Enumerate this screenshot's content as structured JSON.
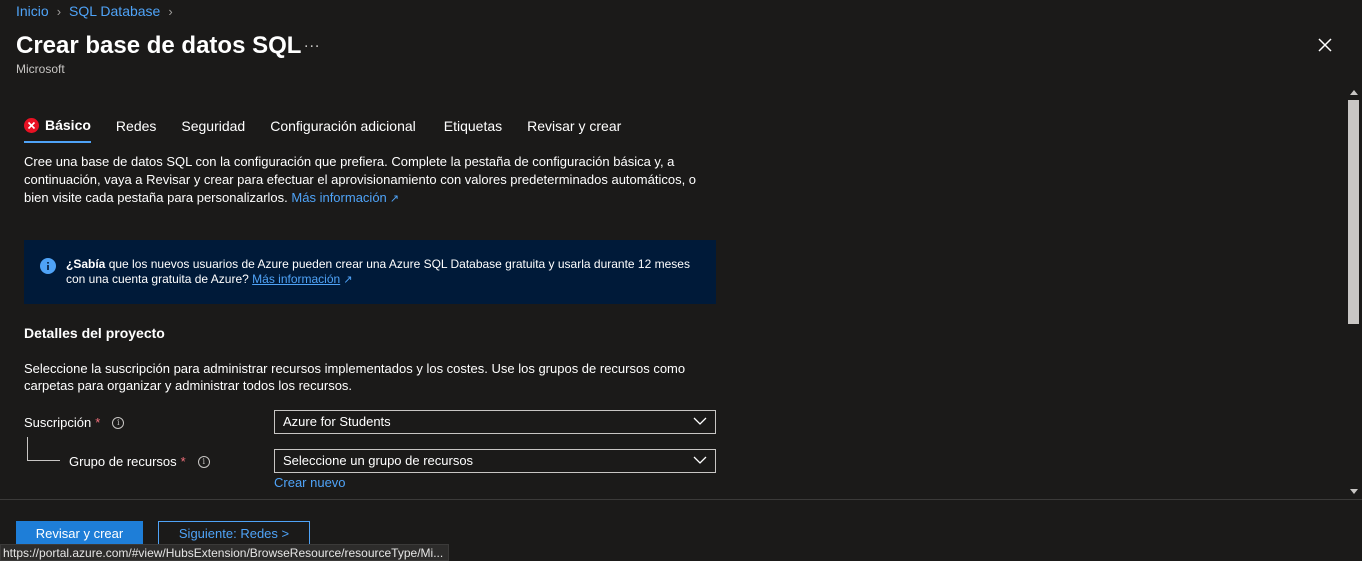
{
  "breadcrumb": {
    "items": [
      "Inicio",
      "SQL Database"
    ]
  },
  "header": {
    "title": "Crear base de datos SQL",
    "more": "...",
    "publisher": "Microsoft"
  },
  "tabs": [
    {
      "label": "Básico",
      "active": true,
      "has_error": true
    },
    {
      "label": "Redes"
    },
    {
      "label": "Seguridad"
    },
    {
      "label": "Configuración adicional"
    },
    {
      "label": "Etiquetas"
    },
    {
      "label": "Revisar y crear"
    }
  ],
  "intro": {
    "text": "Cree una base de datos SQL con la configuración que prefiera. Complete la pestaña de configuración básica y, a continuación, vaya a Revisar y crear para efectuar el aprovisionamiento con valores predeterminados automáticos, o bien visite cada pestaña para personalizarlos.",
    "link": "Más información"
  },
  "infobox": {
    "bold": "¿Sabía",
    "text": "que los nuevos usuarios de Azure pueden crear una Azure SQL Database gratuita y usarla durante 12 meses con una cuenta gratuita de Azure?",
    "link": "Más información"
  },
  "project": {
    "title": "Detalles del proyecto",
    "description": "Seleccione la suscripción para administrar recursos implementados y los costes. Use los grupos de recursos como carpetas para organizar y administrar todos los recursos.",
    "subscription": {
      "label": "Suscripción",
      "required": "*",
      "value": "Azure for Students"
    },
    "resource_group": {
      "label": "Grupo de recursos",
      "required": "*",
      "value": "Seleccione un grupo de recursos",
      "create_link": "Crear nuevo"
    }
  },
  "footer": {
    "primary": "Revisar y crear",
    "secondary": "Siguiente: Redes >"
  },
  "status_url": "https://portal.azure.com/#view/HubsExtension/BrowseResource/resourceType/Mi...",
  "colors": {
    "accent": "#4fa3f7",
    "background": "#1b1a19",
    "error": "#e81123",
    "info_bg": "#001a39"
  }
}
